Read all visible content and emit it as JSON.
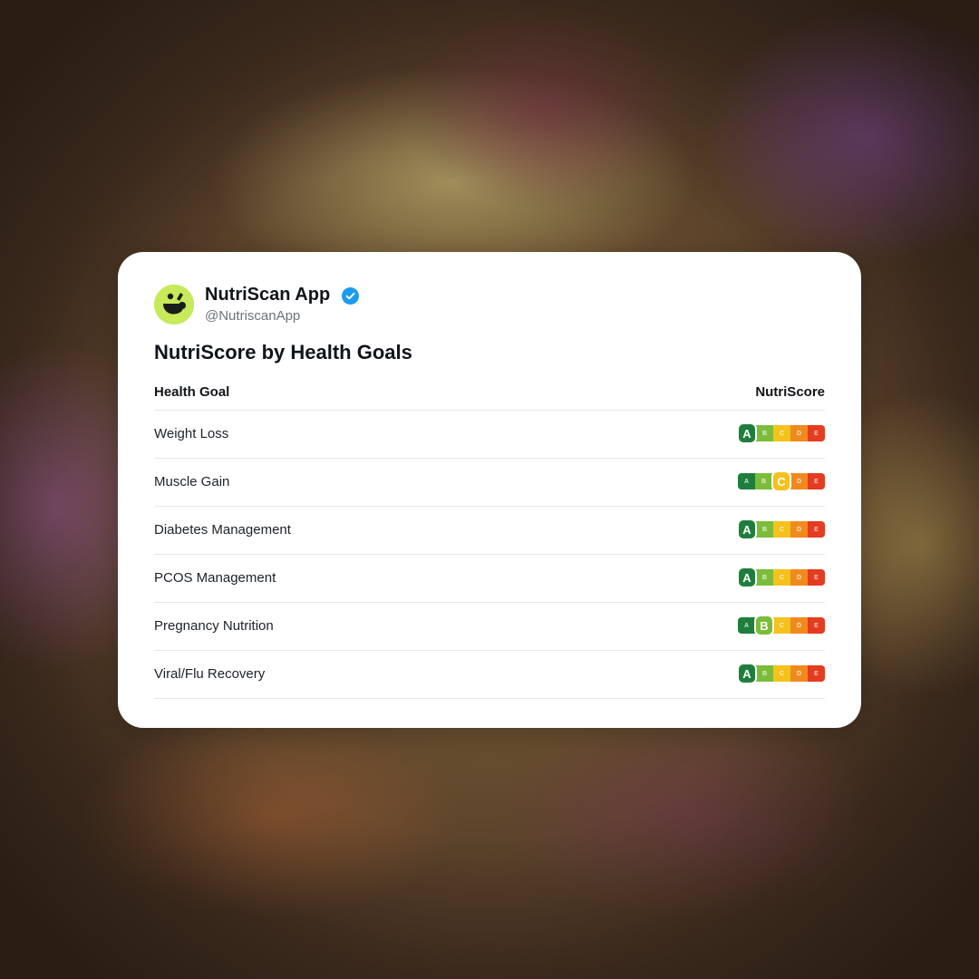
{
  "post": {
    "app_name": "NutriScan App",
    "handle": "@NutriscanApp",
    "verified_icon": "verified-badge-icon",
    "avatar_icon": "nutriscan-logo-icon",
    "title": "NutriScore by Health Goals"
  },
  "table": {
    "headers": [
      "Health Goal",
      "NutriScore"
    ],
    "grades": [
      "A",
      "B",
      "C",
      "D",
      "E"
    ],
    "grade_colors": [
      "#1e7f3c",
      "#7cbc3a",
      "#f4c21c",
      "#f08a1e",
      "#e53b1f"
    ],
    "rows": [
      {
        "goal": "Weight Loss",
        "score": "A"
      },
      {
        "goal": "Muscle Gain",
        "score": "C"
      },
      {
        "goal": "Diabetes Management",
        "score": "A"
      },
      {
        "goal": "PCOS Management",
        "score": "A"
      },
      {
        "goal": "Pregnancy Nutrition",
        "score": "B"
      },
      {
        "goal": "Viral/Flu Recovery",
        "score": "A"
      }
    ]
  }
}
